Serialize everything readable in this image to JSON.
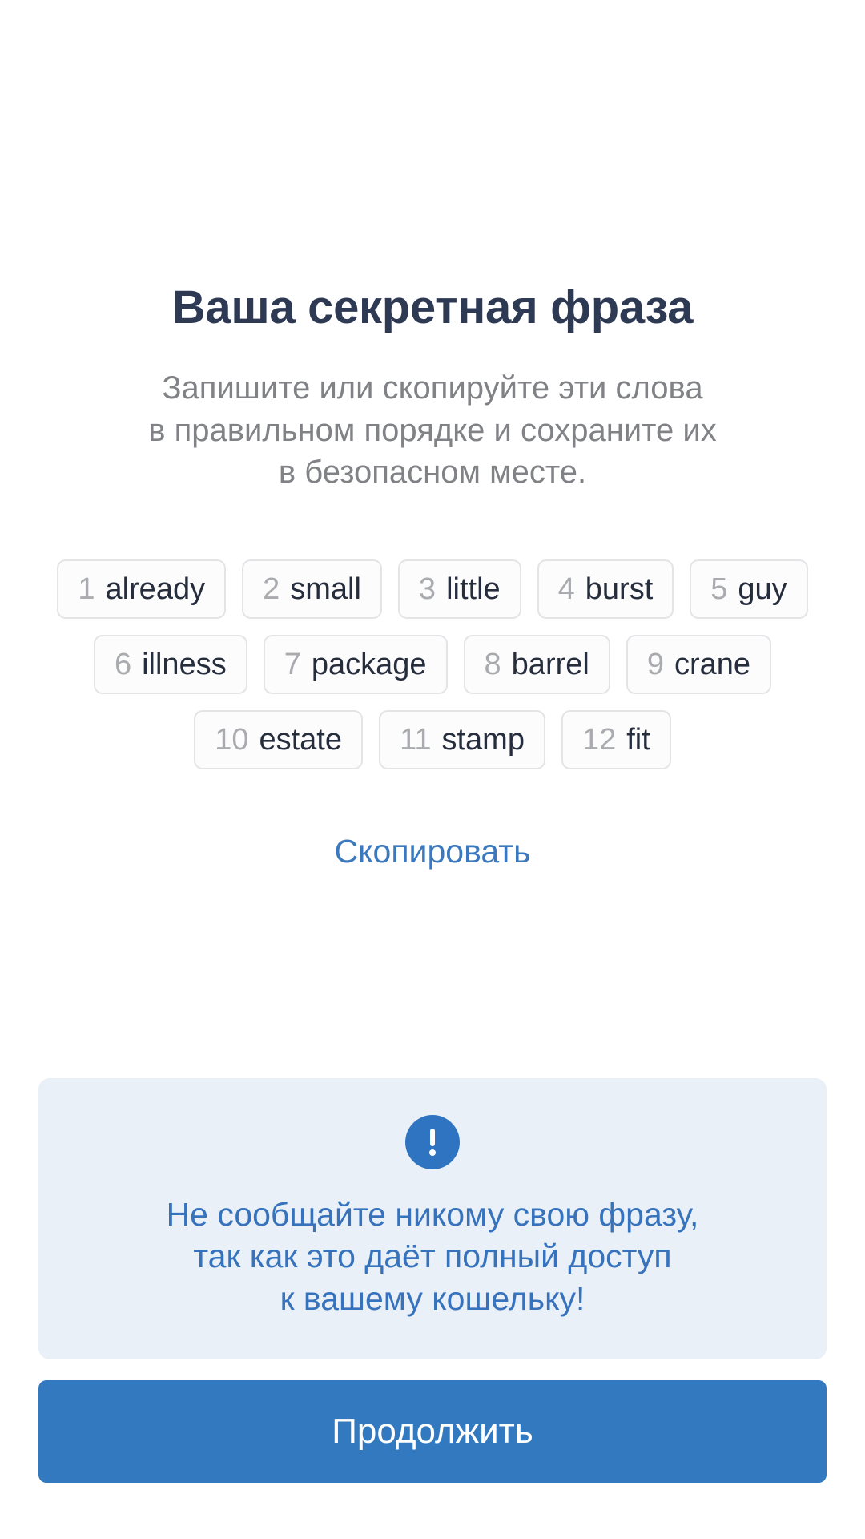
{
  "screen": {
    "title": "Ваша секретная фраза",
    "subtitle_lines": [
      "Запишите или скопируйте эти слова",
      "в правильном порядке и сохраните их",
      "в безопасном месте."
    ]
  },
  "mnemonic": {
    "words": [
      {
        "index": "1",
        "word": "already"
      },
      {
        "index": "2",
        "word": "small"
      },
      {
        "index": "3",
        "word": "little"
      },
      {
        "index": "4",
        "word": "burst"
      },
      {
        "index": "5",
        "word": "guy"
      },
      {
        "index": "6",
        "word": "illness"
      },
      {
        "index": "7",
        "word": "package"
      },
      {
        "index": "8",
        "word": "barrel"
      },
      {
        "index": "9",
        "word": "crane"
      },
      {
        "index": "10",
        "word": "estate"
      },
      {
        "index": "11",
        "word": "stamp"
      },
      {
        "index": "12",
        "word": "fit"
      }
    ]
  },
  "actions": {
    "copy_label": "Скопировать",
    "continue_label": "Продолжить"
  },
  "warning": {
    "icon": "exclamation-circle-icon",
    "lines": [
      "Не сообщайте никому свою фразу,",
      "так как это даёт полный доступ",
      "к вашему кошельку!"
    ]
  },
  "colors": {
    "title": "#2e3a54",
    "subtitle": "#808286",
    "link": "#3b78bd",
    "warning_bg": "#eaf0f8",
    "warning_text": "#3773bd",
    "warning_icon": "#2f74c0",
    "button_bg": "#3279bf",
    "button_text": "#ffffff",
    "chip_border": "#e4e4e7",
    "chip_index": "#a9abaf",
    "chip_word": "#262d3d"
  }
}
